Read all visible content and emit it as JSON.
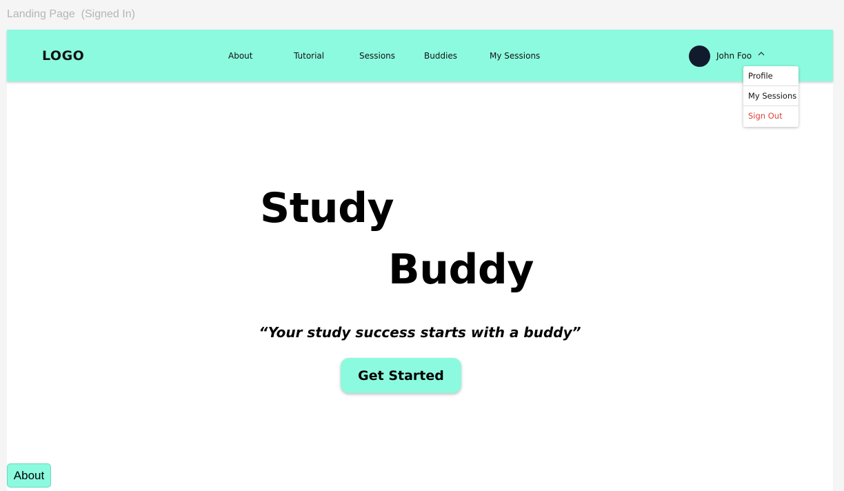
{
  "frame_title": "Landing Page  (Signed In)",
  "navbar": {
    "logo": "LOGO",
    "links": [
      "About",
      "Tutorial",
      "Sessions",
      "Buddies",
      "My Sessions"
    ],
    "user": {
      "name": "John Foo",
      "dropdown_open": true,
      "menu": [
        "Profile",
        "My Sessions",
        "Sign Out"
      ]
    }
  },
  "hero": {
    "title_line1": "Study",
    "title_line2": "Buddy",
    "tagline": "“Your study success starts with a buddy”",
    "cta": "Get Started"
  },
  "floating_button": "About",
  "colors": {
    "accent": "#8cfadf",
    "avatar": "#121a2e",
    "danger": "#e0403a"
  }
}
